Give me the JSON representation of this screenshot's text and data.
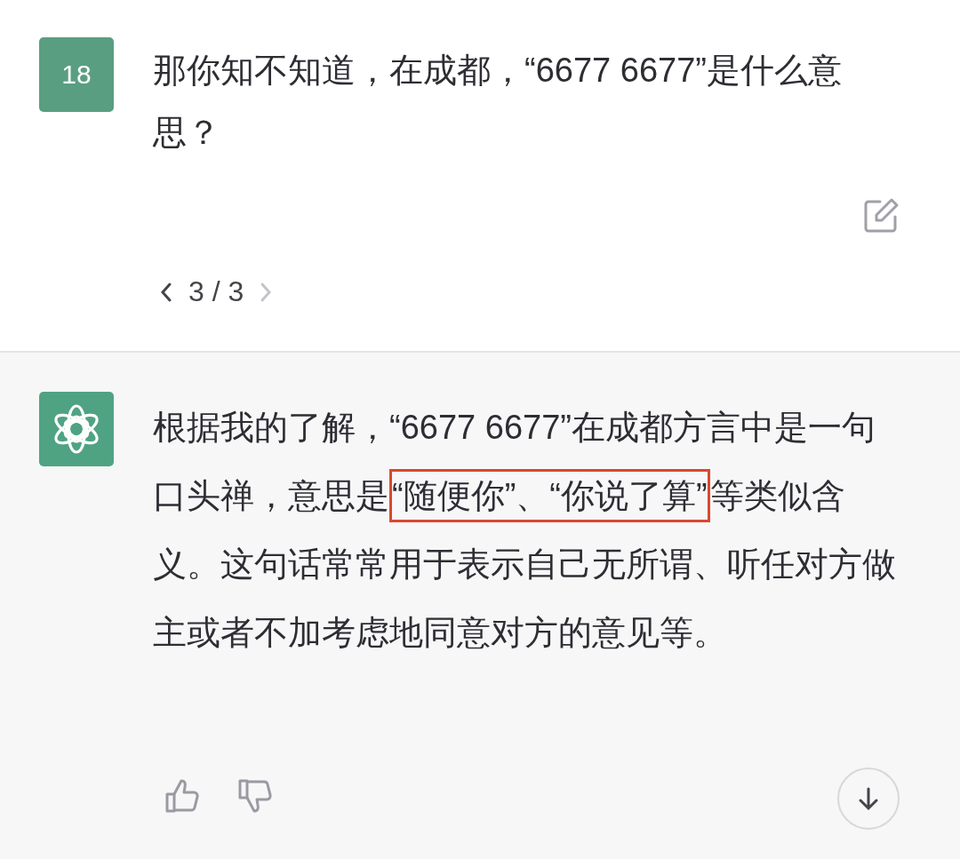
{
  "question": {
    "avatar_text": "18",
    "text": "那你知不知道，在成都，“6677 6677”是什么意思？"
  },
  "pager": {
    "label": "3 / 3",
    "prev_disabled": false,
    "next_disabled": true
  },
  "answer": {
    "segments": [
      {
        "text": "根据我的了解，“6677 6677”在成都方言中是一句口头禅，意思是",
        "highlighted": false
      },
      {
        "text": "“随便你”、“你说了算”",
        "highlighted": true
      },
      {
        "text": "等类似含义。这句话常常用于表示自己无所谓、听任对方做主或者不加考虑地同意对方的意见等。",
        "highlighted": false
      }
    ]
  }
}
